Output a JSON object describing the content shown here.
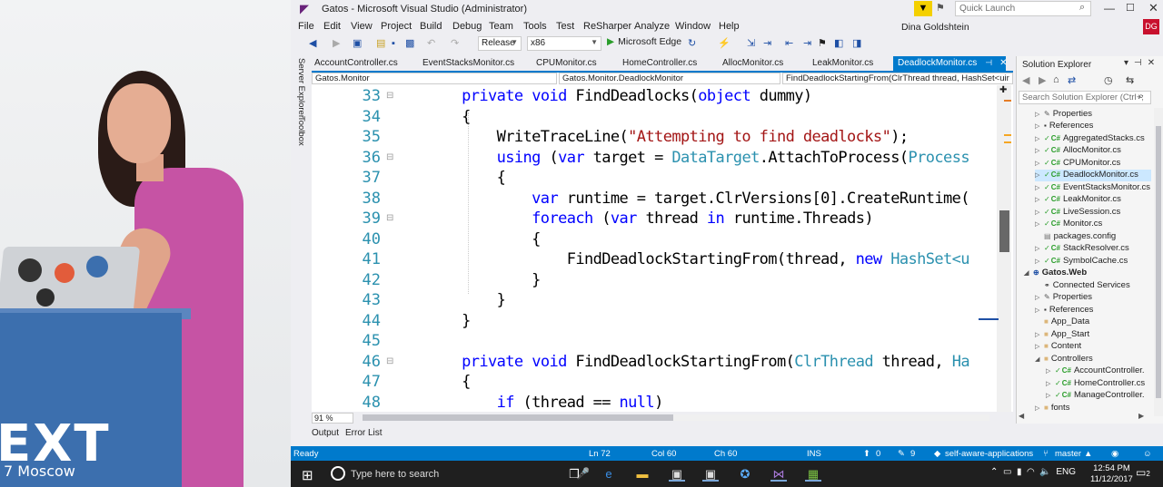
{
  "window": {
    "title": "Gatos - Microsoft Visual Studio (Administrator)",
    "quick_launch_placeholder": "Quick Launch",
    "user": "Dina Goldshtein",
    "user_initials": "DG"
  },
  "menu": [
    "File",
    "Edit",
    "View",
    "Project",
    "Build",
    "Debug",
    "Team",
    "Tools",
    "Test",
    "ReSharper",
    "Analyze",
    "Window",
    "Help"
  ],
  "toolbar": {
    "configuration": "Release",
    "platform": "x86",
    "run_target": "Microsoft Edge"
  },
  "side_tabs": [
    "Server Explorer",
    "Toolbox"
  ],
  "tabs": [
    {
      "label": "AccountController.cs"
    },
    {
      "label": "EventStacksMonitor.cs"
    },
    {
      "label": "CPUMonitor.cs"
    },
    {
      "label": "HomeController.cs"
    },
    {
      "label": "AllocMonitor.cs"
    },
    {
      "label": "LeakMonitor.cs"
    },
    {
      "label": "DeadlockMonitor.cs",
      "active": true
    }
  ],
  "nav": {
    "project": "Gatos.Monitor",
    "type": "Gatos.Monitor.DeadlockMonitor",
    "member": "FindDeadlockStartingFrom(ClrThread thread, HashSet<uir"
  },
  "code": {
    "line_numbers": [
      "33",
      "34",
      "35",
      "36",
      "37",
      "38",
      "39",
      "40",
      "41",
      "42",
      "43",
      "44",
      "45",
      "46",
      "47",
      "48"
    ],
    "zoom": "91 %"
  },
  "bottom_tabs": [
    "Output",
    "Error List"
  ],
  "solution_explorer": {
    "title": "Solution Explorer",
    "search_placeholder": "Search Solution Explorer (Ctrl+;",
    "items": [
      {
        "label": "Properties"
      },
      {
        "label": "References"
      },
      {
        "label": "AggregatedStacks.cs"
      },
      {
        "label": "AllocMonitor.cs"
      },
      {
        "label": "CPUMonitor.cs"
      },
      {
        "label": "DeadlockMonitor.cs"
      },
      {
        "label": "EventStacksMonitor.cs"
      },
      {
        "label": "LeakMonitor.cs"
      },
      {
        "label": "LiveSession.cs"
      },
      {
        "label": "Monitor.cs"
      },
      {
        "label": "packages.config"
      },
      {
        "label": "StackResolver.cs"
      },
      {
        "label": "SymbolCache.cs"
      },
      {
        "label": "Gatos.Web"
      },
      {
        "label": "Connected Services"
      },
      {
        "label": "Properties"
      },
      {
        "label": "References"
      },
      {
        "label": "App_Data"
      },
      {
        "label": "App_Start"
      },
      {
        "label": "Content"
      },
      {
        "label": "Controllers"
      },
      {
        "label": "AccountController."
      },
      {
        "label": "HomeController.cs"
      },
      {
        "label": "ManageController."
      },
      {
        "label": "fonts"
      }
    ]
  },
  "status": {
    "state": "Ready",
    "line": "Ln 72",
    "col": "Col 60",
    "ch": "Ch 60",
    "mode": "INS",
    "up_count": "0",
    "pencil_count": "9",
    "repo": "self-aware-applications",
    "branch": "master"
  },
  "taskbar": {
    "search_placeholder": "Type here to search",
    "lang": "ENG",
    "time": "12:54 PM",
    "date": "11/12/2017",
    "notifications": "2"
  },
  "slide": {
    "brand_fragment": "EXT",
    "city": "7 Moscow"
  },
  "colors": {
    "accent": "#007acc",
    "keyword": "#0000ff",
    "type": "#2b91af",
    "string": "#a31515",
    "vs_purple": "#68217a"
  }
}
